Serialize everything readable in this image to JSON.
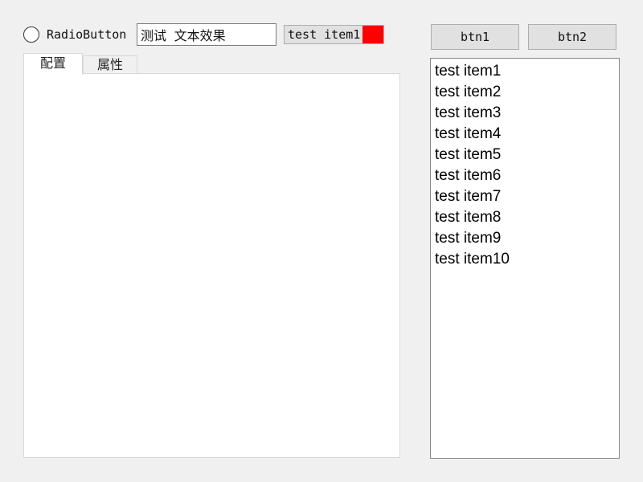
{
  "radio": {
    "label": "RadioButton",
    "checked": false
  },
  "text_input": {
    "value": "测试 文本效果"
  },
  "combo": {
    "selected": "test item1",
    "swatch_color": "#ff0000"
  },
  "tabs": [
    {
      "label": "配置",
      "active": true
    },
    {
      "label": "属性",
      "active": false
    }
  ],
  "buttons": {
    "btn1": "btn1",
    "btn2": "btn2"
  },
  "list": {
    "items": [
      "test item1",
      "test item2",
      "test item3",
      "test item4",
      "test item5",
      "test item6",
      "test item7",
      "test item8",
      "test item9",
      "test item10"
    ]
  }
}
